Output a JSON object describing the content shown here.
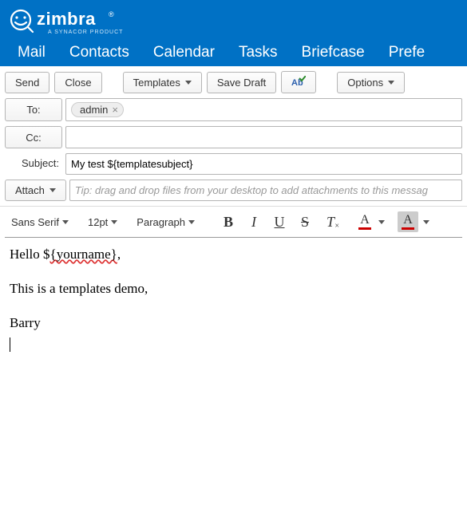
{
  "brand": {
    "name": "zimbra",
    "tagline": "A SYNACOR PRODUCT"
  },
  "nav": {
    "mail": "Mail",
    "contacts": "Contacts",
    "calendar": "Calendar",
    "tasks": "Tasks",
    "briefcase": "Briefcase",
    "preferences": "Prefe"
  },
  "toolbar": {
    "send": "Send",
    "close": "Close",
    "templates": "Templates",
    "save_draft": "Save Draft",
    "options": "Options"
  },
  "fields": {
    "to_label": "To:",
    "to_chip": "admin",
    "cc_label": "Cc:",
    "subject_label": "Subject:",
    "subject_value": "My test ${templatesubject}",
    "attach_label": "Attach",
    "attach_tip": "Tip: drag and drop files from your desktop to add attachments to this messag"
  },
  "format": {
    "font": "Sans Serif",
    "size": "12pt",
    "para": "Paragraph"
  },
  "body": {
    "line1a": "Hello $",
    "line1b": "{yourname}",
    "line1c": ",",
    "line2": "This is a templates demo,",
    "line3": "Barry"
  }
}
